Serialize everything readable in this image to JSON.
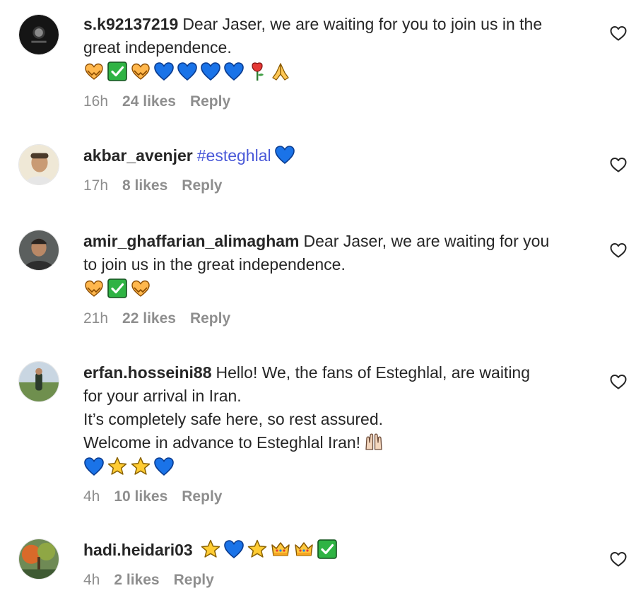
{
  "comments": [
    {
      "username": "s.k92137219",
      "text_lines": [
        "Dear Jaser, we are waiting for you to join us in the",
        "great independence."
      ],
      "emojis": [
        "handshake-heart",
        "check-mark-button",
        "handshake-heart",
        "blue-heart",
        "blue-heart",
        "blue-heart",
        "blue-heart",
        "rose",
        "folded-hands"
      ],
      "time": "16h",
      "likes": "24 likes",
      "reply": "Reply"
    },
    {
      "username": "akbar_avenjer",
      "hashtag": "#esteghlal",
      "inline_emojis": [
        "blue-heart"
      ],
      "time": "17h",
      "likes": "8 likes",
      "reply": "Reply"
    },
    {
      "username": "amir_ghaffarian_alimagham",
      "text_lines": [
        "Dear Jaser, we are waiting for you",
        "to join us in the great independence."
      ],
      "emojis": [
        "handshake-heart",
        "check-mark-button",
        "handshake-heart"
      ],
      "time": "21h",
      "likes": "22 likes",
      "reply": "Reply"
    },
    {
      "username": "erfan.hosseini88",
      "text_lines": [
        "Hello! We, the fans of Esteghlal, are waiting",
        "for your arrival in Iran.",
        "It’s completely safe here, so rest assured.",
        "Welcome in advance to Esteghlal Iran!"
      ],
      "last_line_emojis": [
        "raising-hands"
      ],
      "emojis": [
        "blue-heart",
        "star",
        "star",
        "blue-heart"
      ],
      "time": "4h",
      "likes": "10 likes",
      "reply": "Reply"
    },
    {
      "username": "hadi.heidari03",
      "inline_emojis": [
        "star",
        "blue-heart",
        "star",
        "crown",
        "crown",
        "check-mark-button"
      ],
      "time": "4h",
      "likes": "2 likes",
      "reply": "Reply"
    }
  ],
  "icons": {
    "like": "heart-outline-icon"
  },
  "colors": {
    "text": "#262626",
    "meta": "#8e8e8e",
    "hashtag": "#4a59d8"
  }
}
